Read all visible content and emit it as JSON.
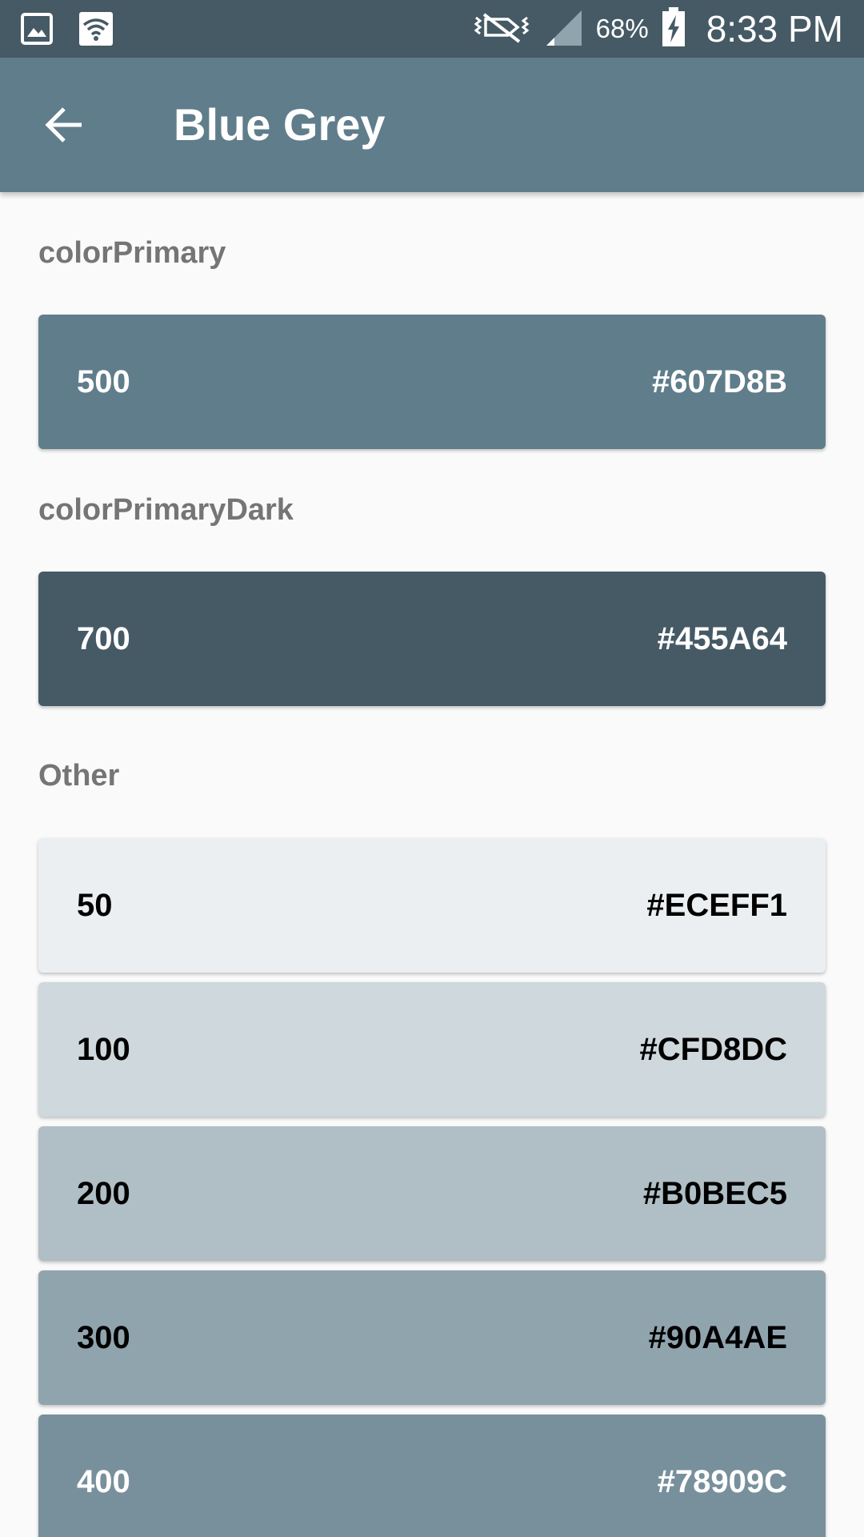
{
  "status_bar": {
    "battery_percent": "68%",
    "time": "8:33 PM",
    "icons": [
      "gallery-icon",
      "wifi-icon",
      "vibrate-off-icon",
      "signal-icon",
      "battery-charging-icon"
    ],
    "background": "#455A64"
  },
  "app_bar": {
    "title": "Blue Grey",
    "back_icon": "arrow-back-icon",
    "background": "#607D8B"
  },
  "sections": {
    "primary": {
      "label": "colorPrimary",
      "swatch": {
        "shade": "500",
        "hex": "#607D8B",
        "bg": "#607D8B",
        "text_color": "#FFFFFF"
      }
    },
    "primary_dark": {
      "label": "colorPrimaryDark",
      "swatch": {
        "shade": "700",
        "hex": "#455A64",
        "bg": "#455A64",
        "text_color": "#FFFFFF"
      }
    },
    "other": {
      "label": "Other",
      "swatches": [
        {
          "shade": "50",
          "hex": "#ECEFF1",
          "bg": "#ECEFF1",
          "text_color": "#000000"
        },
        {
          "shade": "100",
          "hex": "#CFD8DC",
          "bg": "#CFD8DC",
          "text_color": "#000000"
        },
        {
          "shade": "200",
          "hex": "#B0BEC5",
          "bg": "#B0BEC5",
          "text_color": "#000000"
        },
        {
          "shade": "300",
          "hex": "#90A4AE",
          "bg": "#90A4AE",
          "text_color": "#000000"
        },
        {
          "shade": "400",
          "hex": "#78909C",
          "bg": "#78909C",
          "text_color": "#FFFFFF"
        }
      ]
    }
  }
}
